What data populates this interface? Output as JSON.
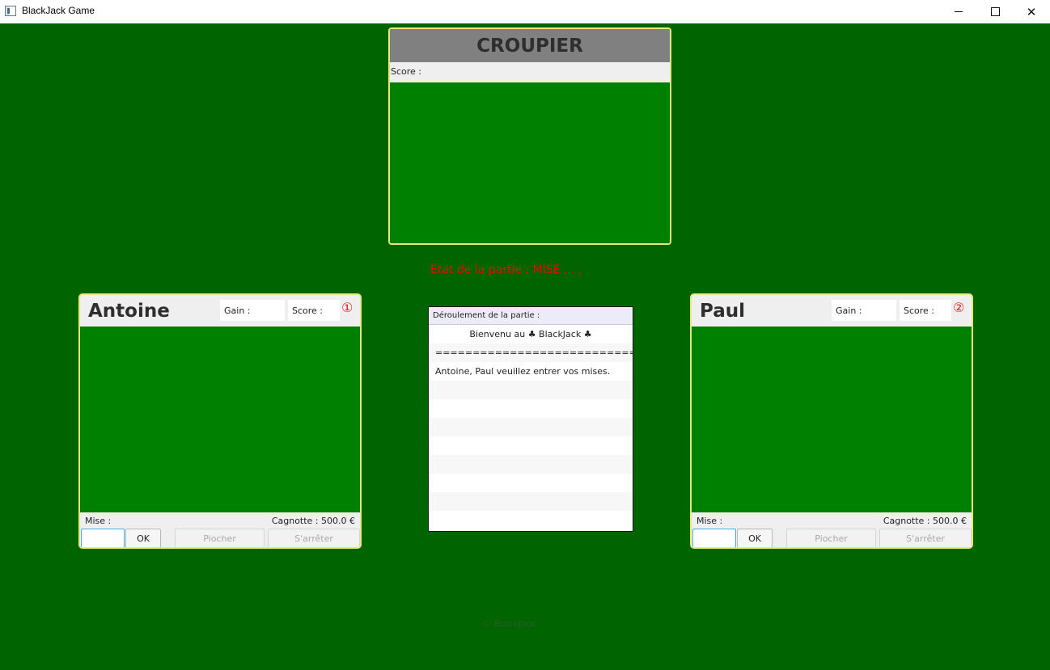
{
  "window": {
    "title": "BlackJack Game",
    "icon": "app-window-icon",
    "close_glyph": "✕"
  },
  "dealer": {
    "title": "CROUPIER",
    "score_label": "Score :"
  },
  "game_state": "Etat de la partie : MISE . . .",
  "players": [
    {
      "name": "Antoine",
      "gain_label": "Gain :",
      "score_label": "Score :",
      "number": "①",
      "mise_label": "Mise :",
      "cagnotte": "Cagnotte : 500.0 €",
      "mise_value": "",
      "ok_label": "OK",
      "draw_label": "Piocher",
      "stop_label": "S'arrêter"
    },
    {
      "name": "Paul",
      "gain_label": "Gain :",
      "score_label": "Score :",
      "number": "②",
      "mise_label": "Mise :",
      "cagnotte": "Cagnotte : 500.0 €",
      "mise_value": "",
      "ok_label": "OK",
      "draw_label": "Piocher",
      "stop_label": "S'arrêter"
    }
  ],
  "log": {
    "title": "Déroulement de la partie :",
    "lines": [
      "Bienvenu au ♣ BlackJack ♣",
      "===========================",
      "Antoine, Paul veuillez entrer vos mises.",
      "",
      "",
      "",
      "",
      "",
      "",
      "",
      ""
    ]
  },
  "footer": "© BlackJack",
  "colors": {
    "table_green": "#006400",
    "area_green": "#008000",
    "panel_border": "#e8e87a",
    "state_red": "#ff0000"
  }
}
